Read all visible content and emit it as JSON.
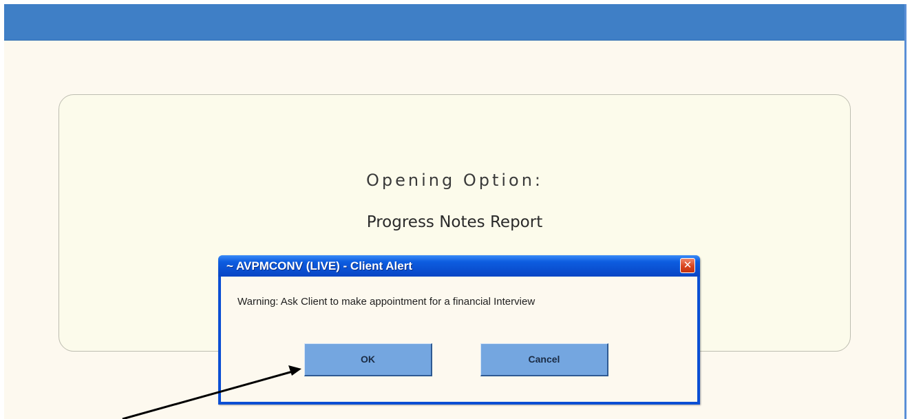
{
  "panel": {
    "heading": "Opening Option:",
    "report_name": "Progress Notes Report"
  },
  "dialog": {
    "title": "~ AVPMCONV (LIVE) - Client Alert",
    "message": "Warning: Ask Client to make appointment for a financial Interview",
    "close_icon": "close-icon",
    "buttons": {
      "ok_label": "OK",
      "cancel_label": "Cancel"
    }
  },
  "colors": {
    "top_bar": "#3f7fc6",
    "background": "#fdf9ef",
    "dialog_frame": "#0b4fd4",
    "button_face": "#74a6e0",
    "close_button": "#d9441e"
  }
}
